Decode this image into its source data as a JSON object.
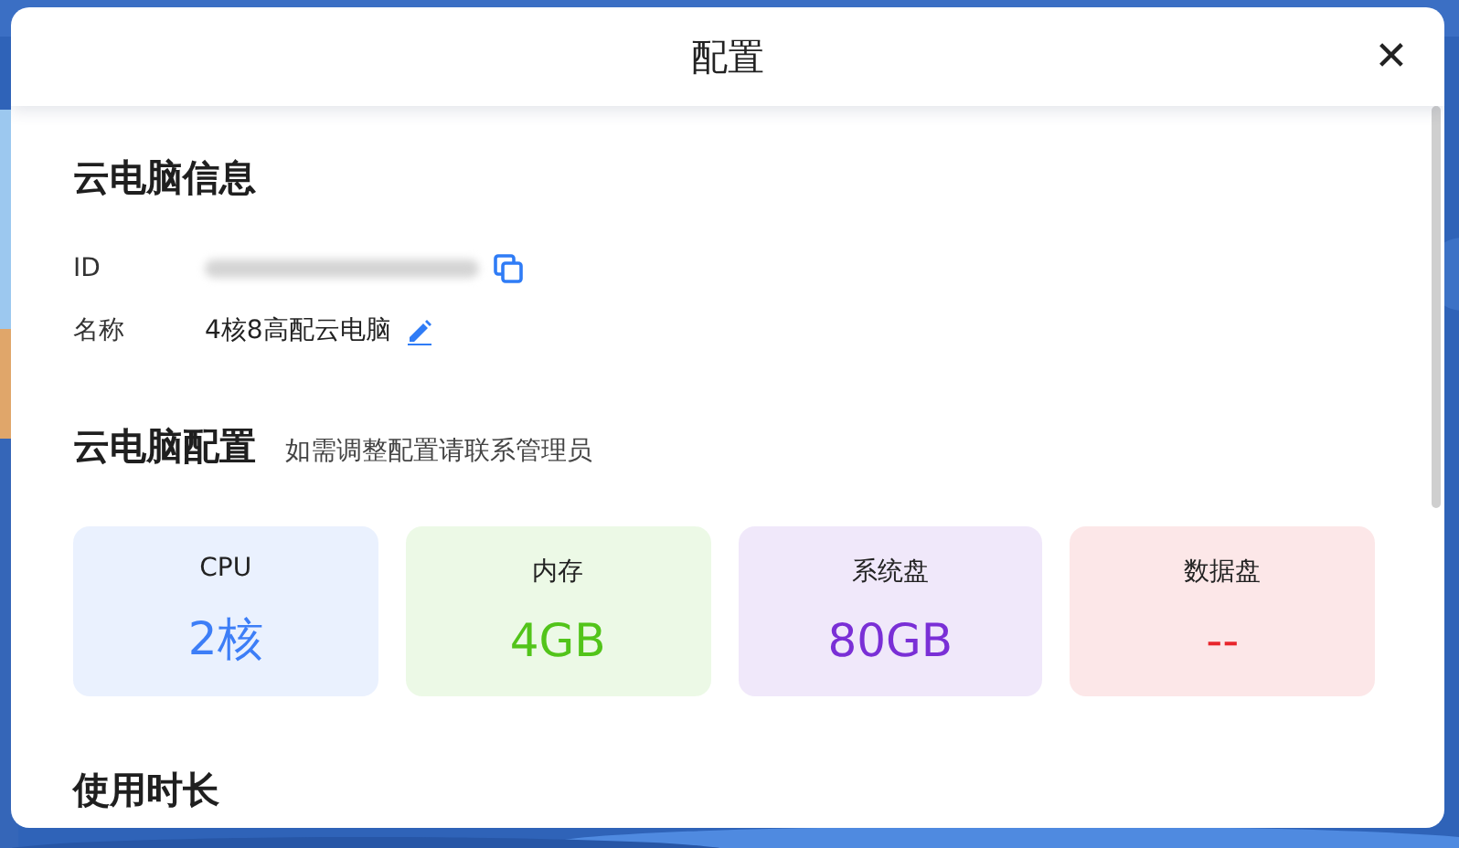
{
  "dialog": {
    "title": "配置",
    "close": "✕"
  },
  "info": {
    "title": "云电脑信息",
    "rows": [
      {
        "kind": "redacted",
        "label": "ID"
      },
      {
        "kind": "editable",
        "label": "名称",
        "value": "4核8高配云电脑"
      }
    ]
  },
  "config": {
    "title": "云电脑配置",
    "hint": "如需调整配置请联系管理员",
    "cards": [
      {
        "label": "CPU",
        "value": "2核",
        "color": "#3d7ef7"
      },
      {
        "label": "内存",
        "value": "4GB",
        "color": "#52c41a"
      },
      {
        "label": "系统盘",
        "value": "80GB",
        "color": "#7a2fd6"
      },
      {
        "label": "数据盘",
        "value": "--",
        "color": "#e8262c"
      }
    ]
  },
  "usage": {
    "title": "使用时长"
  }
}
